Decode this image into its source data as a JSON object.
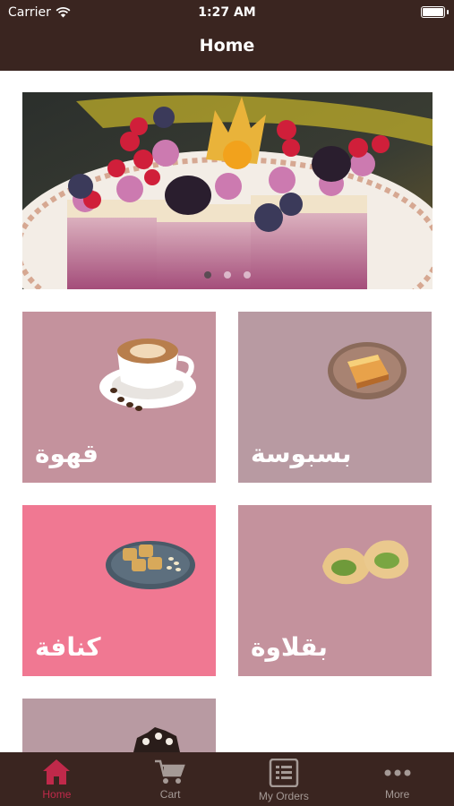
{
  "status_bar": {
    "carrier": "Carrier",
    "time": "1:27 AM"
  },
  "nav": {
    "title": "Home"
  },
  "banner": {
    "page_count": 3,
    "active_page": 1
  },
  "categories": [
    {
      "label": "قهوة",
      "color": "#c4929d",
      "image": "coffee-cup"
    },
    {
      "label": "بسبوسة",
      "color": "#b89aa2",
      "image": "basbousa-plate"
    },
    {
      "label": "كنافة",
      "color": "#f07892",
      "image": "kunafa-plate"
    },
    {
      "label": "بقلاوة",
      "color": "#c4929d",
      "image": "baklava-pastries"
    },
    {
      "label": "",
      "color": "#b89aa2",
      "image": "chocolate-cake"
    }
  ],
  "tabbar": {
    "items": [
      {
        "label": "Home",
        "icon": "home-icon",
        "active": true
      },
      {
        "label": "Cart",
        "icon": "cart-icon",
        "active": false
      },
      {
        "label": "My Orders",
        "icon": "orders-icon",
        "active": false
      },
      {
        "label": "More",
        "icon": "more-icon",
        "active": false
      }
    ]
  },
  "colors": {
    "header": "#3a2520",
    "accent": "#c0294a",
    "tab_inactive": "#a59a96"
  }
}
